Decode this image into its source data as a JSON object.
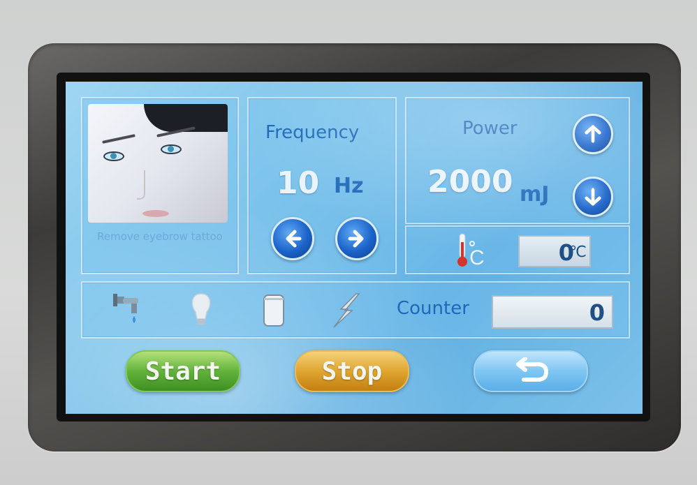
{
  "treatment": {
    "label": "Remove eyebrow tattoo"
  },
  "frequency": {
    "label": "Frequency",
    "value": "10",
    "unit": "Hz"
  },
  "power": {
    "label": "Power",
    "value": "2000",
    "unit": "mJ"
  },
  "temperature": {
    "value": "0",
    "unit": "℃"
  },
  "status_icons": [
    "water-tap-icon",
    "light-bulb-icon",
    "tank-icon",
    "lightning-icon"
  ],
  "counter": {
    "label": "Counter",
    "value": "0"
  },
  "buttons": {
    "start": "Start",
    "stop": "Stop",
    "back_icon": "return-arrow-icon"
  },
  "colors": {
    "accent": "#1f68b8",
    "start": "#62b33b",
    "stop": "#e0a630",
    "screen": "#7fc4ea"
  }
}
